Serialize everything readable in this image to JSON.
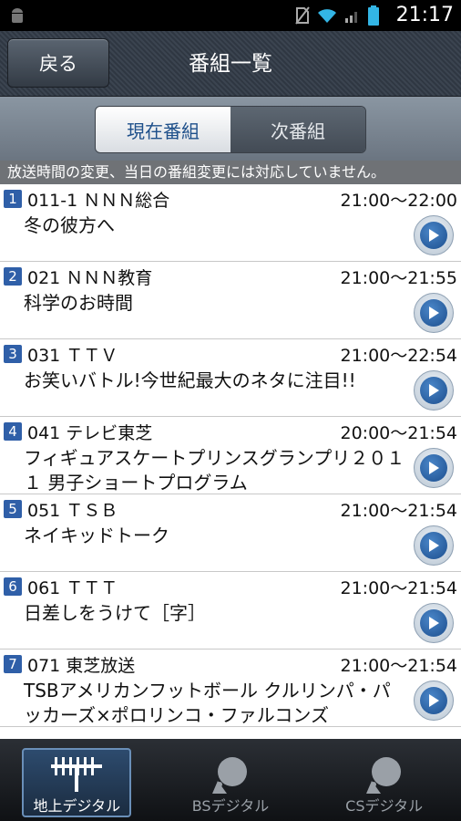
{
  "status_bar": {
    "time": "21:17"
  },
  "header": {
    "back_label": "戻る",
    "title": "番組一覧"
  },
  "tabs": [
    {
      "label": "現在番組",
      "active": true
    },
    {
      "label": "次番組",
      "active": false
    }
  ],
  "notice": "放送時間の変更、当日の番組変更には対応していません。",
  "programs": [
    {
      "index": "1",
      "channel": "011-1 ＮＮＮ総合",
      "time": "21:00～22:00",
      "title": "冬の彼方へ"
    },
    {
      "index": "2",
      "channel": "021 ＮＮＮ教育",
      "time": "21:00～21:55",
      "title": "科学のお時間"
    },
    {
      "index": "3",
      "channel": "031 ＴＴＶ",
      "time": "21:00～22:54",
      "title": "お笑いバトル!今世紀最大のネタに注目!!"
    },
    {
      "index": "4",
      "channel": "041 テレビ東芝",
      "time": "20:00～21:54",
      "title": "フィギュアスケートプリンスグランプリ２０１１ 男子ショートプログラム"
    },
    {
      "index": "5",
      "channel": "051 ＴＳＢ",
      "time": "21:00～21:54",
      "title": "ネイキッドトーク"
    },
    {
      "index": "6",
      "channel": "061 ＴＴＴ",
      "time": "21:00～21:54",
      "title": "日差しをうけて［字］"
    },
    {
      "index": "7",
      "channel": "071 東芝放送",
      "time": "21:00～21:54",
      "title": "TSBアメリカンフットボール クルリンパ・パッカーズ×ポロリンコ・ファルコンズ"
    }
  ],
  "bottom_nav": [
    {
      "label": "地上デジタル",
      "active": true
    },
    {
      "label": "BSデジタル",
      "active": false
    },
    {
      "label": "CSデジタル",
      "active": false
    }
  ]
}
